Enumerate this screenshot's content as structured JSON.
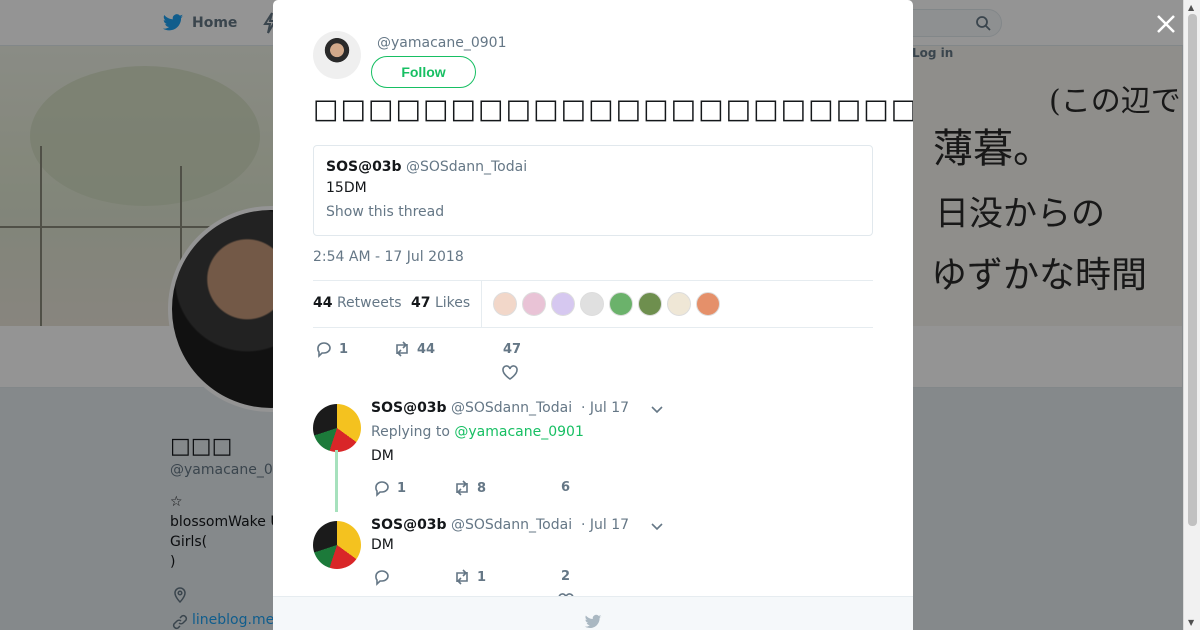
{
  "nav": {
    "home_label": "Home",
    "login_label": "Log in"
  },
  "profile": {
    "name": "□□□",
    "handle": "@yamacane_0",
    "bio_lines": [
      "☆",
      "blossomWake U",
      "Girls(",
      ")"
    ],
    "link": "lineblog.me"
  },
  "tweet": {
    "author_handle": "@yamacane_0901",
    "follow_label": "Follow",
    "text": "□□□□□□□□□□□□□□□□□□□□□□□□□□□□",
    "quoted": {
      "name": "SOS@03b",
      "handle": "@SOSdann_Todai",
      "body": "15DM",
      "show_thread": "Show this thread"
    },
    "timestamp": "2:54 AM - 17 Jul 2018",
    "retweets_count": "44",
    "retweets_label": "Retweets",
    "likes_count": "47",
    "likes_label": "Likes",
    "liker_colors": [
      "#f2d7c9",
      "#e9c3d6",
      "#d6c8f0",
      "#e0e0e0",
      "#6bb26b",
      "#6e8f4e",
      "#efe7d6",
      "#e5906a"
    ],
    "actions": {
      "replies": "1",
      "retweets": "44",
      "likes": "47"
    }
  },
  "replies": [
    {
      "name": "SOS@03b",
      "handle": "@SOSdann_Todai",
      "time": "· Jul 17",
      "replying_prefix": "Replying to",
      "replying_to": "@yamacane_0901",
      "body": "DM",
      "actions": {
        "replies": "1",
        "retweets": "8",
        "likes": "6"
      }
    },
    {
      "name": "SOS@03b",
      "handle": "@SOSdann_Todai",
      "time": "· Jul 17",
      "body": "DM",
      "actions": {
        "replies": "",
        "retweets": "1",
        "likes": "2"
      }
    }
  ],
  "colors": {
    "accent": "#17bf63",
    "muted": "#657786",
    "text": "#14171a"
  }
}
